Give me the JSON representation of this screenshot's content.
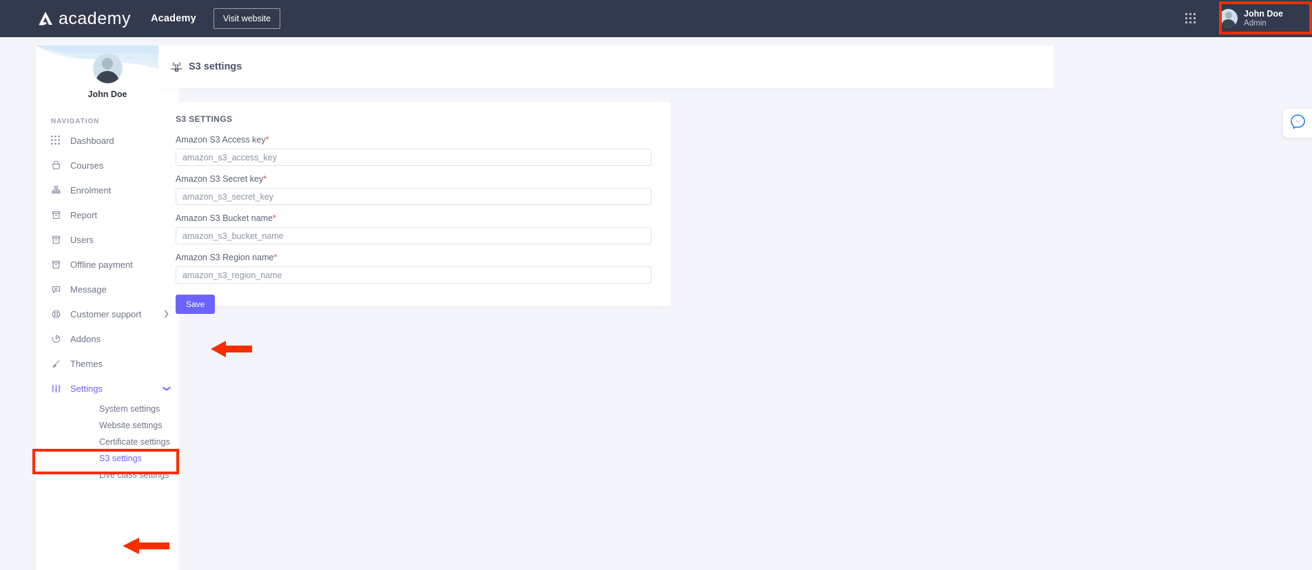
{
  "topbar": {
    "logo_text": "academy",
    "logo_icon": "academy-logo-icon",
    "app_name": "Academy",
    "visit_button": "Visit website",
    "grid_icon": "apps-grid-icon",
    "profile": {
      "name": "John Doe",
      "role": "Admin",
      "avatar_icon": "user-avatar-icon"
    }
  },
  "sidebar": {
    "profile_name": "John Doe",
    "section_label": "NAVIGATION",
    "items": [
      {
        "label": "Dashboard",
        "icon": "grid-dots-icon",
        "has_chevron": false,
        "active": false
      },
      {
        "label": "Courses",
        "icon": "basket-icon",
        "has_chevron": true,
        "active": false
      },
      {
        "label": "Enrolment",
        "icon": "hierarchy-icon",
        "has_chevron": true,
        "active": false
      },
      {
        "label": "Report",
        "icon": "archive-icon",
        "has_chevron": true,
        "active": false
      },
      {
        "label": "Users",
        "icon": "archive-icon",
        "has_chevron": true,
        "active": false
      },
      {
        "label": "Offline payment",
        "icon": "archive-icon",
        "has_chevron": true,
        "active": false
      },
      {
        "label": "Message",
        "icon": "chat-bubble-icon",
        "has_chevron": false,
        "active": false
      },
      {
        "label": "Customer support",
        "icon": "lifebuoy-icon",
        "has_chevron": true,
        "active": false
      },
      {
        "label": "Addons",
        "icon": "pie-chart-icon",
        "has_chevron": false,
        "active": false
      },
      {
        "label": "Themes",
        "icon": "brush-icon",
        "has_chevron": false,
        "active": false
      },
      {
        "label": "Settings",
        "icon": "sliders-icon",
        "has_chevron": true,
        "active": true
      }
    ],
    "settings_subitems": [
      {
        "label": "System settings",
        "active": false
      },
      {
        "label": "Website settings",
        "active": false
      },
      {
        "label": "Certificate settings",
        "active": false
      },
      {
        "label": "S3 settings",
        "active": true
      },
      {
        "label": "Live class settings",
        "active": false
      }
    ]
  },
  "page": {
    "title": "S3 settings",
    "title_icon": "command-icon"
  },
  "card": {
    "heading": "S3 SETTINGS",
    "required_marker": "*",
    "fields": [
      {
        "label": "Amazon S3 Access key",
        "required": true,
        "placeholder": "amazon_s3_access_key",
        "value": ""
      },
      {
        "label": "Amazon S3 Secret key",
        "required": true,
        "placeholder": "amazon_s3_secret_key",
        "value": ""
      },
      {
        "label": "Amazon S3 Bucket name",
        "required": true,
        "placeholder": "amazon_s3_bucket_name",
        "value": ""
      },
      {
        "label": "Amazon S3 Region name",
        "required": true,
        "placeholder": "amazon_s3_region_name",
        "value": ""
      }
    ],
    "save_label": "Save"
  },
  "chat": {
    "icon": "messenger-icon"
  },
  "annotations": {
    "highlight_color": "#f92d00",
    "boxes": [
      "profile-chip",
      "sidebar-item-settings"
    ],
    "arrows": [
      "points-to-save-button",
      "points-to-s3-settings-subitem"
    ]
  },
  "colors": {
    "topbar_bg": "#343a4d",
    "accent": "#6c63ff",
    "page_bg": "#f4f5fa",
    "required": "#f0483e",
    "annotation": "#f92d00"
  }
}
